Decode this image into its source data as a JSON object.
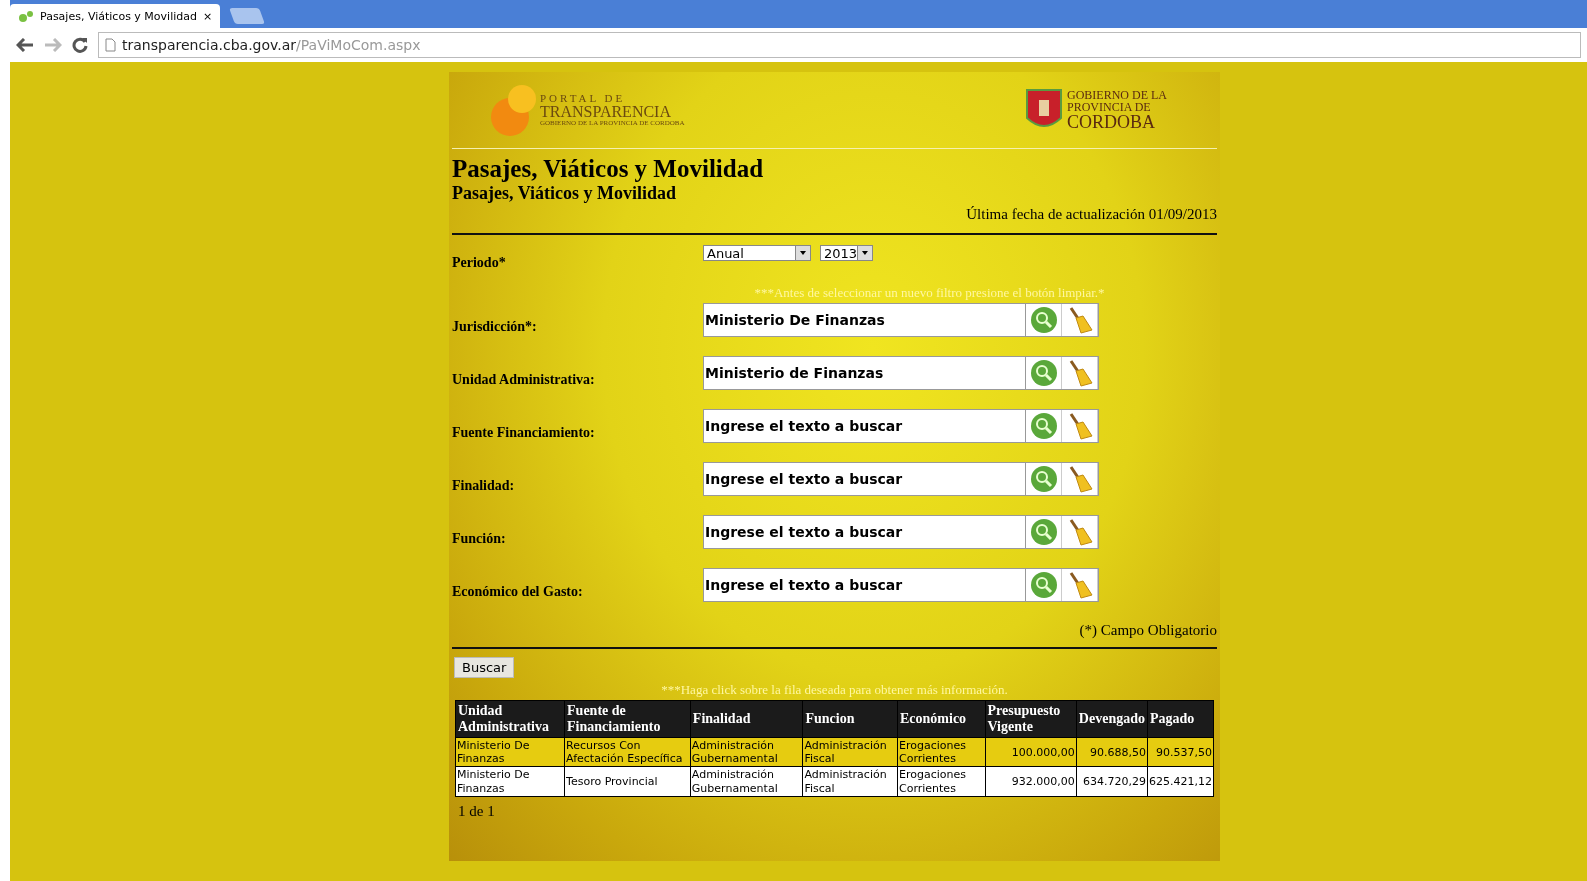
{
  "browser": {
    "tab_title": "Pasajes, Viáticos y Movilidad",
    "tab_close": "×",
    "url_host": "transparencia.cba.gov.ar",
    "url_path": "/PaViMoCom.aspx"
  },
  "header": {
    "portal_top": "PORTAL  DE",
    "portal_name": "TRANSPARENCIA",
    "portal_sub": "GOBIERNO DE LA PROVINCIA DE CORDOBA",
    "gov_lines": [
      "GOBIERNO DE LA",
      "PROVINCIA DE",
      "CORDOBA"
    ]
  },
  "title": "Pasajes, Viáticos y Movilidad",
  "subtitle": "Pasajes, Viáticos y Movilidad",
  "updated": "Última fecha de actualización 01/09/2013",
  "periodo": {
    "label": "Periodo*",
    "type_value": "Anual",
    "year_value": "2013"
  },
  "filter_note": "***Antes de seleccionar un nuevo filtro presione el botón limpiar.*",
  "filters": [
    {
      "label": "Jurisdicción*:",
      "value": "Ministerio De Finanzas"
    },
    {
      "label": "Unidad Administrativa:",
      "value": "Ministerio de Finanzas"
    },
    {
      "label": "Fuente Financiamiento:",
      "value": "Ingrese el texto a buscar"
    },
    {
      "label": "Finalidad:",
      "value": "Ingrese el texto a buscar"
    },
    {
      "label": "Función:",
      "value": "Ingrese el texto a buscar"
    },
    {
      "label": "Económico del Gasto:",
      "value": "Ingrese el texto a buscar"
    }
  ],
  "required_note": "(*) Campo Obligatorio",
  "search_button": "Buscar",
  "table_note": "***Haga click sobre la fila deseada para obtener más información.",
  "table": {
    "columns": [
      "Unidad Administrativa",
      "Fuente de Financiamiento",
      "Finalidad",
      "Funcion",
      "Económico",
      "Presupuesto Vigente",
      "Devengado",
      "Pagado"
    ],
    "rows": [
      {
        "highlighted": true,
        "cells": [
          "Ministerio De Finanzas",
          "Recursos Con Afectación Específica",
          "Administración Gubernamental",
          "Administración Fiscal",
          "Erogaciones Corrientes",
          "100.000,00",
          "90.688,50",
          "90.537,50"
        ]
      },
      {
        "highlighted": false,
        "cells": [
          "Ministerio De Finanzas",
          "Tesoro Provincial",
          "Administración Gubernamental",
          "Administración Fiscal",
          "Erogaciones Corrientes",
          "932.000,00",
          "634.720,29",
          "625.421,12"
        ]
      }
    ]
  },
  "pager": "1 de 1"
}
